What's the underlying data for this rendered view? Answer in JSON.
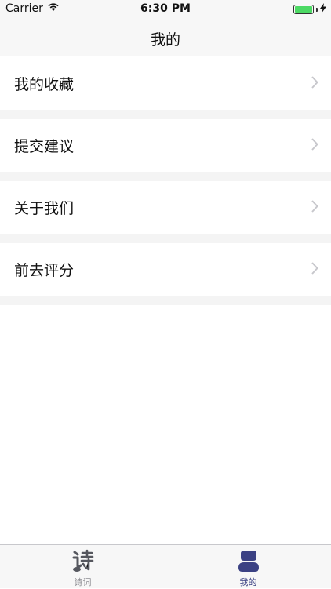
{
  "status_bar": {
    "carrier": "Carrier",
    "time": "6:30 PM",
    "battery_level": 1.0
  },
  "nav": {
    "title": "我的"
  },
  "menu": {
    "items": [
      {
        "label": "我的收藏"
      },
      {
        "label": "提交建议"
      },
      {
        "label": "关于我们"
      },
      {
        "label": "前去评分"
      }
    ]
  },
  "tabs": [
    {
      "label": "诗词",
      "icon": "poem-icon",
      "active": false
    },
    {
      "label": "我的",
      "icon": "user-icon",
      "active": true
    }
  ],
  "colors": {
    "accent": "#3b4183",
    "inactive": "#8e8e93",
    "battery": "#4cd964"
  }
}
